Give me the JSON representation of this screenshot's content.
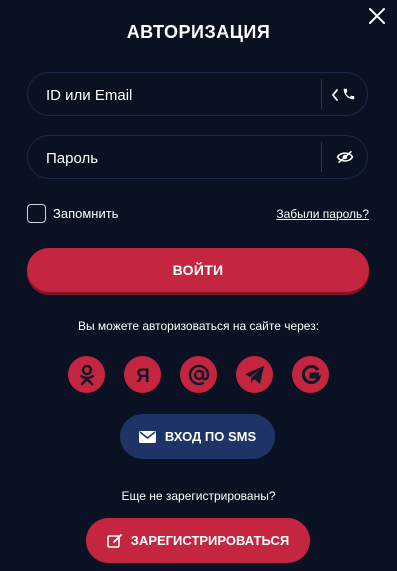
{
  "modal": {
    "title": "АВТОРИЗАЦИЯ",
    "close_icon": "close-icon"
  },
  "form": {
    "login_placeholder": "ID или Email",
    "login_value": "",
    "password_placeholder": "Пароль",
    "password_value": "",
    "login_icons": [
      "chevron-left-icon",
      "phone-icon"
    ],
    "password_icon": "eye-hidden-icon",
    "remember_label": "Запомнить",
    "remember_checked": false,
    "forgot_label": "Забыли пароль?",
    "submit_label": "ВОЙТИ"
  },
  "social": {
    "prompt": "Вы можете авторизоваться на сайте через:",
    "providers": [
      "odnoklassniki-icon",
      "yandex-icon",
      "mailru-icon",
      "telegram-icon",
      "google-icon"
    ]
  },
  "sms": {
    "label": "ВХОД ПО SMS",
    "icon": "envelope-icon"
  },
  "register": {
    "prompt": "Еще не зарегистрированы?",
    "label": "ЗАРЕГИСТРИРОВАТЬСЯ",
    "icon": "edit-icon"
  },
  "colors": {
    "background": "#0a1122",
    "accent": "#c3263e",
    "sms_button": "#1e3366"
  }
}
